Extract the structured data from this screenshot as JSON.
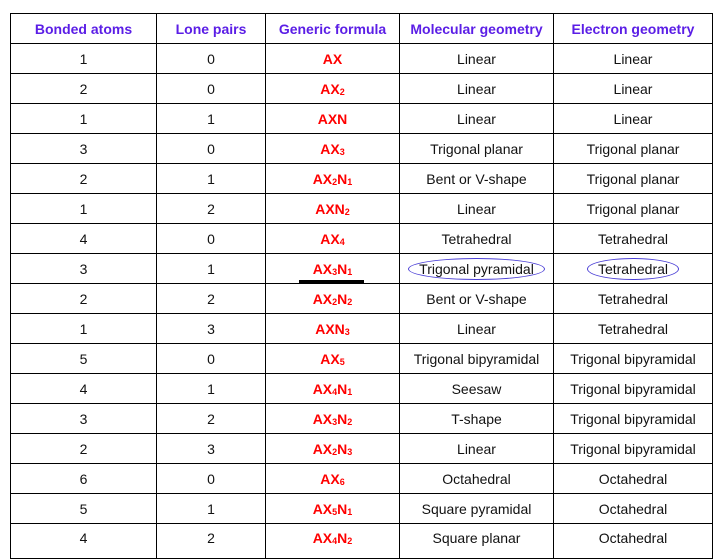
{
  "table": {
    "headers": [
      "Bonded atoms",
      "Lone pairs",
      "Generic formula",
      "Molecular geometry",
      "Electron geometry"
    ],
    "rows": [
      {
        "bonded": "1",
        "lone": "0",
        "formula": [
          [
            "AX",
            ""
          ]
        ],
        "molecular": "Linear",
        "electron": "Linear"
      },
      {
        "bonded": "2",
        "lone": "0",
        "formula": [
          [
            "AX",
            "2"
          ]
        ],
        "molecular": "Linear",
        "electron": "Linear"
      },
      {
        "bonded": "1",
        "lone": "1",
        "formula": [
          [
            "AXN",
            ""
          ]
        ],
        "molecular": "Linear",
        "electron": "Linear"
      },
      {
        "bonded": "3",
        "lone": "0",
        "formula": [
          [
            "AX",
            "3"
          ]
        ],
        "molecular": "Trigonal planar",
        "electron": "Trigonal planar"
      },
      {
        "bonded": "2",
        "lone": "1",
        "formula": [
          [
            "AX",
            "2"
          ],
          [
            "N",
            "1"
          ]
        ],
        "molecular": "Bent or V-shape",
        "electron": "Trigonal planar"
      },
      {
        "bonded": "1",
        "lone": "2",
        "formula": [
          [
            "AXN",
            "2"
          ]
        ],
        "molecular": "Linear",
        "electron": "Trigonal planar"
      },
      {
        "bonded": "4",
        "lone": "0",
        "formula": [
          [
            "AX",
            "4"
          ]
        ],
        "molecular": "Tetrahedral",
        "electron": "Tetrahedral"
      },
      {
        "bonded": "3",
        "lone": "1",
        "formula": [
          [
            "AX",
            "3"
          ],
          [
            "N",
            "1"
          ]
        ],
        "molecular": "Trigonal pyramidal",
        "electron": "Tetrahedral",
        "highlighted": true
      },
      {
        "bonded": "2",
        "lone": "2",
        "formula": [
          [
            "AX",
            "2"
          ],
          [
            "N",
            "2"
          ]
        ],
        "molecular": "Bent or V-shape",
        "electron": "Tetrahedral"
      },
      {
        "bonded": "1",
        "lone": "3",
        "formula": [
          [
            "AXN",
            "3"
          ]
        ],
        "molecular": "Linear",
        "electron": "Tetrahedral"
      },
      {
        "bonded": "5",
        "lone": "0",
        "formula": [
          [
            "AX",
            "5"
          ]
        ],
        "molecular": "Trigonal bipyramidal",
        "electron": "Trigonal bipyramidal"
      },
      {
        "bonded": "4",
        "lone": "1",
        "formula": [
          [
            "AX",
            "4"
          ],
          [
            "N",
            "1"
          ]
        ],
        "molecular": "Seesaw",
        "electron": "Trigonal bipyramidal"
      },
      {
        "bonded": "3",
        "lone": "2",
        "formula": [
          [
            "AX",
            "3"
          ],
          [
            "N",
            "2"
          ]
        ],
        "molecular": "T-shape",
        "electron": "Trigonal bipyramidal"
      },
      {
        "bonded": "2",
        "lone": "3",
        "formula": [
          [
            "AX",
            "2"
          ],
          [
            "N",
            "3"
          ]
        ],
        "molecular": "Linear",
        "electron": "Trigonal bipyramidal"
      },
      {
        "bonded": "6",
        "lone": "0",
        "formula": [
          [
            "AX",
            "6"
          ]
        ],
        "molecular": "Octahedral",
        "electron": "Octahedral"
      },
      {
        "bonded": "5",
        "lone": "1",
        "formula": [
          [
            "AX",
            "5"
          ],
          [
            "N",
            "1"
          ]
        ],
        "molecular": "Square pyramidal",
        "electron": "Octahedral"
      },
      {
        "bonded": "4",
        "lone": "2",
        "formula": [
          [
            "AX",
            "4"
          ],
          [
            "N",
            "2"
          ]
        ],
        "molecular": "Square planar",
        "electron": "Octahedral"
      }
    ]
  }
}
